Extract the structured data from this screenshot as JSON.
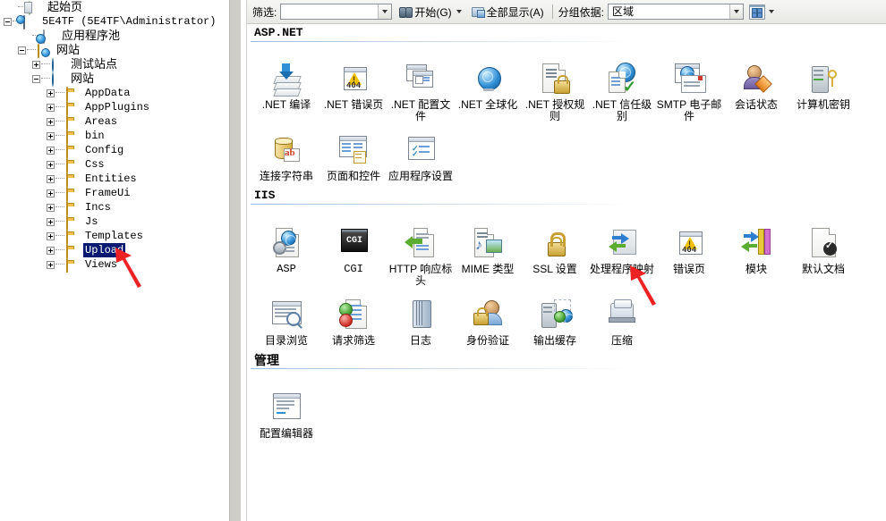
{
  "tree": {
    "nodes": [
      {
        "label": "起始页",
        "icon": "start-page-icon",
        "indent": 1,
        "expander": "none",
        "cjk": true,
        "selected": false
      },
      {
        "label": "5E4TF (5E4TF\\Administrator)",
        "icon": "server-icon",
        "indent": 0,
        "expander": "minus",
        "cjk": false,
        "selected": false
      },
      {
        "label": "应用程序池",
        "icon": "app-pool-icon",
        "indent": 2,
        "expander": "none",
        "cjk": true,
        "selected": false
      },
      {
        "label": "网站",
        "icon": "sites-folder-icon",
        "indent": 1,
        "expander": "minus",
        "cjk": true,
        "selected": false
      },
      {
        "label": "测试站点",
        "icon": "site-globe-icon",
        "indent": 2,
        "expander": "plus",
        "cjk": true,
        "selected": false
      },
      {
        "label": "网站",
        "icon": "site-globe-icon",
        "indent": 2,
        "expander": "minus",
        "cjk": true,
        "selected": false
      },
      {
        "label": "AppData",
        "icon": "folder-icon",
        "indent": 3,
        "expander": "plus",
        "cjk": false,
        "selected": false
      },
      {
        "label": "AppPlugins",
        "icon": "folder-icon",
        "indent": 3,
        "expander": "plus",
        "cjk": false,
        "selected": false
      },
      {
        "label": "Areas",
        "icon": "folder-icon",
        "indent": 3,
        "expander": "plus",
        "cjk": false,
        "selected": false
      },
      {
        "label": "bin",
        "icon": "folder-icon",
        "indent": 3,
        "expander": "plus",
        "cjk": false,
        "selected": false
      },
      {
        "label": "Config",
        "icon": "folder-icon",
        "indent": 3,
        "expander": "plus",
        "cjk": false,
        "selected": false
      },
      {
        "label": "Css",
        "icon": "folder-icon",
        "indent": 3,
        "expander": "plus",
        "cjk": false,
        "selected": false
      },
      {
        "label": "Entities",
        "icon": "folder-icon",
        "indent": 3,
        "expander": "plus",
        "cjk": false,
        "selected": false
      },
      {
        "label": "FrameUi",
        "icon": "folder-icon",
        "indent": 3,
        "expander": "plus",
        "cjk": false,
        "selected": false
      },
      {
        "label": "Incs",
        "icon": "folder-icon",
        "indent": 3,
        "expander": "plus",
        "cjk": false,
        "selected": false
      },
      {
        "label": "Js",
        "icon": "folder-icon",
        "indent": 3,
        "expander": "plus",
        "cjk": false,
        "selected": false
      },
      {
        "label": "Templates",
        "icon": "folder-icon",
        "indent": 3,
        "expander": "plus",
        "cjk": false,
        "selected": false
      },
      {
        "label": "Upload",
        "icon": "folder-icon",
        "indent": 3,
        "expander": "plus",
        "cjk": false,
        "selected": true
      },
      {
        "label": "Views",
        "icon": "folder-icon",
        "indent": 3,
        "expander": "plus",
        "cjk": false,
        "selected": false
      }
    ],
    "selection_color": "#0a1a72"
  },
  "toolbar": {
    "filter_label": "筛选:",
    "filter_value": "",
    "filter_placeholder": "",
    "go_label": "开始(G)",
    "show_all_label": "全部显示(A)",
    "group_by_label": "分组依据:",
    "group_by_value": "区域"
  },
  "sections": [
    {
      "title": "ASP.NET",
      "title_cjk": false,
      "items": [
        {
          "label": ".NET 编译",
          "icon": "net-compilation-icon"
        },
        {
          "label": ".NET 错误页",
          "icon": "net-error-pages-icon"
        },
        {
          "label": ".NET 配置文件",
          "icon": "net-profile-icon"
        },
        {
          "label": ".NET 全球化",
          "icon": "net-globalization-icon"
        },
        {
          "label": ".NET 授权规则",
          "icon": "net-authorization-rules-icon"
        },
        {
          "label": ".NET 信任级别",
          "icon": "net-trust-levels-icon"
        },
        {
          "label": "SMTP 电子邮件",
          "icon": "smtp-email-icon"
        },
        {
          "label": "会话状态",
          "icon": "session-state-icon"
        },
        {
          "label": "计算机密钥",
          "icon": "machine-key-icon"
        },
        {
          "label": "连接字符串",
          "icon": "connection-strings-icon"
        },
        {
          "label": "页面和控件",
          "icon": "pages-and-controls-icon"
        },
        {
          "label": "应用程序设置",
          "icon": "application-settings-icon"
        }
      ]
    },
    {
      "title": "IIS",
      "title_cjk": false,
      "items": [
        {
          "label": "ASP",
          "icon": "asp-icon"
        },
        {
          "label": "CGI",
          "icon": "cgi-icon"
        },
        {
          "label": "HTTP 响应标头",
          "icon": "http-response-headers-icon"
        },
        {
          "label": "MIME 类型",
          "icon": "mime-types-icon"
        },
        {
          "label": "SSL 设置",
          "icon": "ssl-settings-icon"
        },
        {
          "label": "处理程序映射",
          "icon": "handler-mappings-icon"
        },
        {
          "label": "错误页",
          "icon": "error-pages-icon"
        },
        {
          "label": "模块",
          "icon": "modules-icon"
        },
        {
          "label": "默认文档",
          "icon": "default-document-icon"
        },
        {
          "label": "目录浏览",
          "icon": "directory-browsing-icon"
        },
        {
          "label": "请求筛选",
          "icon": "request-filtering-icon"
        },
        {
          "label": "日志",
          "icon": "logging-icon"
        },
        {
          "label": "身份验证",
          "icon": "authentication-icon"
        },
        {
          "label": "输出缓存",
          "icon": "output-caching-icon"
        },
        {
          "label": "压缩",
          "icon": "compression-icon"
        }
      ]
    },
    {
      "title": "管理",
      "title_cjk": true,
      "items": [
        {
          "label": "配置编辑器",
          "icon": "configuration-editor-icon"
        }
      ]
    }
  ],
  "annotations": {
    "arrow_color": "#ee2222",
    "arrows": [
      {
        "name": "arrow-pointing-to-upload",
        "target": "Upload"
      },
      {
        "name": "arrow-pointing-to-handler-mappings",
        "target": "处理程序映射"
      }
    ]
  }
}
